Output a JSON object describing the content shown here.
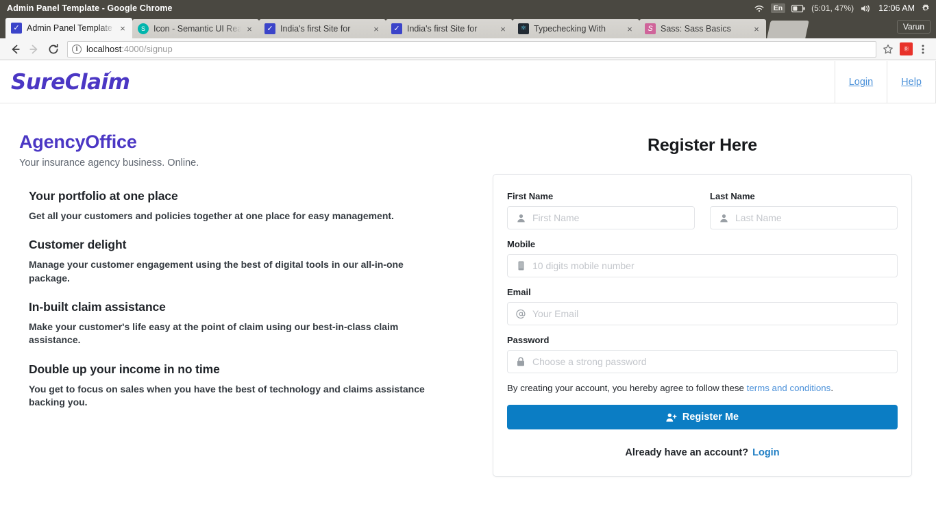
{
  "os": {
    "window_title": "Admin Panel Template - Google Chrome",
    "tray": {
      "wifi_icon": "wifi-icon",
      "language": "En",
      "battery_icon": "battery-icon",
      "battery_status": "(5:01, 47%)",
      "volume_icon": "volume-icon",
      "clock": "12:06 AM",
      "settings_icon": "gear-icon"
    }
  },
  "browser": {
    "tabs": [
      {
        "title": "Admin Panel Template",
        "favicon": "checkmark-favicon",
        "active": true
      },
      {
        "title": "Icon - Semantic UI React",
        "favicon": "semantic-ui-favicon",
        "active": false
      },
      {
        "title": "India's first Site for",
        "favicon": "checkmark-favicon",
        "active": false
      },
      {
        "title": "India's first Site for",
        "favicon": "checkmark-favicon",
        "active": false
      },
      {
        "title": "Typechecking With",
        "favicon": "react-favicon",
        "active": false
      },
      {
        "title": "Sass: Sass Basics",
        "favicon": "sass-favicon",
        "active": false
      }
    ],
    "tab_close_label": "×",
    "profile_name": "Varun",
    "toolbar": {
      "back_icon": "back-arrow-icon",
      "forward_icon": "forward-arrow-icon",
      "reload_icon": "reload-icon",
      "site_info_icon": "info-icon",
      "url_host": "localhost",
      "url_path": ":4000/signup",
      "bookmark_icon": "star-icon",
      "extension_icon": "extension-icon",
      "menu_icon": "three-dot-menu-icon"
    }
  },
  "site": {
    "brand": "SureClaim",
    "brand_tick": "✓",
    "nav": [
      {
        "label": "Login"
      },
      {
        "label": "Help"
      }
    ]
  },
  "left": {
    "title": "AgencyOffice",
    "subtitle": "Your insurance agency business. Online.",
    "features": [
      {
        "heading": "Your portfolio at one place",
        "body": "Get all your customers and policies together at one place for easy management."
      },
      {
        "heading": "Customer delight",
        "body": "Manage your customer engagement using the best of digital tools in our all-in-one package."
      },
      {
        "heading": "In-built claim assistance",
        "body": "Make your customer's life easy at the point of claim using our best-in-class claim assistance."
      },
      {
        "heading": "Double up your income in no time",
        "body": "You get to focus on sales when you have the best of technology and claims assistance backing you."
      }
    ]
  },
  "register": {
    "title": "Register Here",
    "fields": {
      "first_name": {
        "label": "First Name",
        "placeholder": "First Name",
        "value": "",
        "icon": "user-icon"
      },
      "last_name": {
        "label": "Last Name",
        "placeholder": "Last Name",
        "value": "",
        "icon": "user-icon"
      },
      "mobile": {
        "label": "Mobile",
        "placeholder": "10 digits mobile number",
        "value": "",
        "icon": "mobile-icon"
      },
      "email": {
        "label": "Email",
        "placeholder": "Your Email",
        "value": "",
        "icon": "at-icon"
      },
      "password": {
        "label": "Password",
        "placeholder": "Choose a strong password",
        "value": "",
        "icon": "lock-icon"
      }
    },
    "terms_prefix": "By creating your account, you hereby agree to follow these ",
    "terms_link": "terms and conditions",
    "terms_suffix": ".",
    "submit_label": "Register Me",
    "submit_icon": "user-plus-icon",
    "already_text": "Already have an account?",
    "already_link": "Login"
  },
  "colors": {
    "brand_purple": "#4b37c4",
    "link_blue": "#4a90d9",
    "button_blue": "#0b7dc4",
    "os_bar": "#4a4841"
  }
}
